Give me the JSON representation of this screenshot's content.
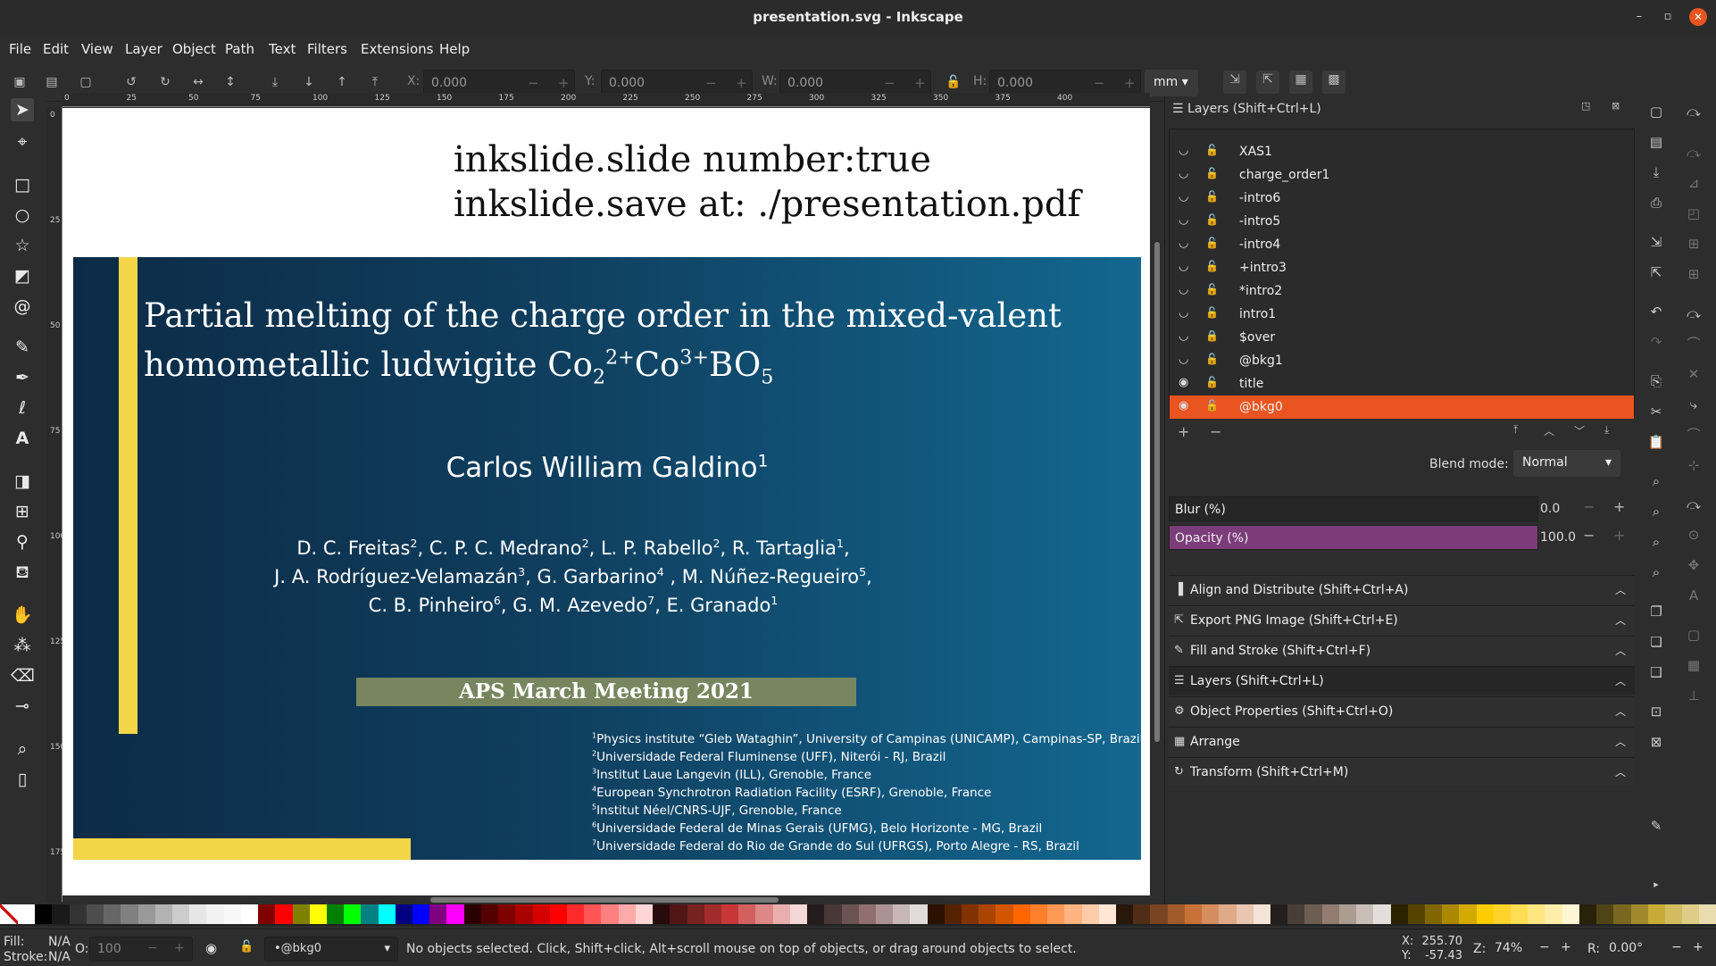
{
  "window": {
    "title": "presentation.svg - Inkscape"
  },
  "menu": [
    "File",
    "Edit",
    "View",
    "Layer",
    "Object",
    "Path",
    "Text",
    "Filters",
    "Extensions",
    "Help"
  ],
  "toolbar": {
    "x_label": "X:",
    "x": "0.000",
    "y_label": "Y:",
    "y": "0.000",
    "w_label": "W:",
    "w": "0.000",
    "h_label": "H:",
    "h": "0.000",
    "unit": "mm",
    "minus": "−",
    "plus": "+"
  },
  "ruler": {
    "h": [
      "0",
      "25",
      "50",
      "75",
      "100",
      "125",
      "150",
      "175",
      "200",
      "225",
      "250",
      "275",
      "300",
      "325",
      "350",
      "375",
      "400"
    ],
    "v": [
      "0",
      "25",
      "50",
      "75",
      "100",
      "125",
      "150",
      "175"
    ]
  },
  "canvas": {
    "note_line1": "inkslide.slide number:true",
    "note_line2": "inkslide.save at: ./presentation.pdf",
    "slide": {
      "title_l1": "Partial melting of the charge order in the mixed-valent",
      "title_l2_pre": "homometallic ludwigite Co",
      "title_sub1": "2",
      "title_sup1": "2+",
      "title_mid": "Co",
      "title_sup2": "3+",
      "title_end": "BO",
      "title_sub2": "5",
      "author": "Carlos William Galdino",
      "author_sup": "1",
      "coauthors": [
        [
          [
            "D. C. Freitas",
            "2"
          ],
          [
            ", C. P. C. Medrano",
            "2"
          ],
          [
            ", L. P. Rabello",
            "2"
          ],
          [
            ", R. Tartaglia",
            "1"
          ],
          [
            ",",
            ""
          ]
        ],
        [
          [
            "J. A. Rodríguez-Velamazán",
            "3"
          ],
          [
            ", G. Garbarino",
            "4"
          ],
          [
            " , M. Núñez-Regueiro",
            "5"
          ],
          [
            ",",
            ""
          ]
        ],
        [
          [
            "C. B. Pinheiro",
            "6"
          ],
          [
            ", G. M. Azevedo",
            "7"
          ],
          [
            ", E. Granado",
            "1"
          ]
        ]
      ],
      "banner": "APS March Meeting 2021",
      "affiliations": [
        {
          "n": "1",
          "t": "Physics institute “Gleb Wataghin”, University of Campinas (UNICAMP), Campinas-SP, Brazil"
        },
        {
          "n": "2",
          "t": "Universidade Federal Fluminense (UFF), Niterói - RJ, Brazil"
        },
        {
          "n": "3",
          "t": "Institut Laue Langevin (ILL),  Grenoble, France"
        },
        {
          "n": "4",
          "t": "European Synchrotron Radiation Facility (ESRF), Grenoble, France"
        },
        {
          "n": "5",
          "t": "Institut Néel/CNRS-UJF, Grenoble, France"
        },
        {
          "n": "6",
          "t": "Universidade Federal de Minas Gerais (UFMG), Belo Horizonte - MG, Brazil"
        },
        {
          "n": "7",
          "t": "Universidade Federal do Rio de Grande do Sul (UFRGS), Porto Alegre - RS, Brazil"
        }
      ]
    }
  },
  "layers_panel": {
    "title": "Layers (Shift+Ctrl+L)",
    "layers": [
      {
        "name": "XAS1",
        "visible": false,
        "locked": false
      },
      {
        "name": "charge_order1",
        "visible": false,
        "locked": false
      },
      {
        "name": "-intro6",
        "visible": false,
        "locked": false
      },
      {
        "name": "-intro5",
        "visible": false,
        "locked": false
      },
      {
        "name": "-intro4",
        "visible": false,
        "locked": false
      },
      {
        "name": "+intro3",
        "visible": false,
        "locked": false
      },
      {
        "name": "*intro2",
        "visible": false,
        "locked": false
      },
      {
        "name": "intro1",
        "visible": false,
        "locked": false
      },
      {
        "name": "$over",
        "visible": false,
        "locked": true
      },
      {
        "name": "@bkg1",
        "visible": false,
        "locked": false
      },
      {
        "name": "title",
        "visible": true,
        "locked": false
      },
      {
        "name": "@bkg0",
        "visible": true,
        "locked": false,
        "selected": true
      }
    ],
    "add": "+",
    "remove": "−",
    "blend_label": "Blend mode:",
    "blend_value": "Normal",
    "blur_label": "Blur (%)",
    "blur_value": "0.0",
    "opacity_label": "Opacity (%)",
    "opacity_value": "100.0",
    "sections": [
      "Align and Distribute (Shift+Ctrl+A)",
      "Export PNG Image (Shift+Ctrl+E)",
      "Fill and Stroke (Shift+Ctrl+F)",
      "Layers (Shift+Ctrl+L)",
      "Object Properties (Shift+Ctrl+O)",
      "Arrange",
      "Transform (Shift+Ctrl+M)"
    ]
  },
  "status": {
    "fill_label": "Fill:",
    "fill_value": "N/A",
    "stroke_label": "Stroke:",
    "stroke_value": "N/A",
    "opacity_label": "O:",
    "opacity_value": "100",
    "layer": "•@bkg0",
    "message": "No objects selected. Click, Shift+click, Alt+scroll mouse on top of objects, or drag around objects to select.",
    "x_label": "X:",
    "x": "255.70",
    "y_label": "Y:",
    "y": "-57.43",
    "zoom_label": "Z:",
    "zoom": "74%",
    "rot_label": "R:",
    "rot": "0.00°"
  },
  "palette": [
    "#ffffff",
    "#000000",
    "#1a1a1a",
    "#333333",
    "#4d4d4d",
    "#666666",
    "#808080",
    "#999999",
    "#b3b3b3",
    "#cccccc",
    "#e6e6e6",
    "#f2f2f2",
    "#f8f8f8",
    "#ffffff",
    "#800000",
    "#ff0000",
    "#808000",
    "#ffff00",
    "#008000",
    "#00ff00",
    "#008080",
    "#00ffff",
    "#000080",
    "#0000ff",
    "#800080",
    "#ff00ff",
    "#2b0000",
    "#550000",
    "#800000",
    "#aa0000",
    "#d40000",
    "#ff0000",
    "#ff2a2a",
    "#ff5555",
    "#ff8080",
    "#ffaaaa",
    "#ffd5d5",
    "#280b0b",
    "#501616",
    "#782121",
    "#a02c2c",
    "#c83737",
    "#d35f5f",
    "#de8787",
    "#e9afaf",
    "#f4d7d7",
    "#241c1c",
    "#483737",
    "#6c5353",
    "#916f6f",
    "#ac9393",
    "#c8b7b7",
    "#e3dbdb",
    "#2b1100",
    "#552200",
    "#803300",
    "#aa4400",
    "#d45500",
    "#ff6600",
    "#ff7f2a",
    "#ff9955",
    "#ffb380",
    "#ffccaa",
    "#ffe6d5",
    "#28170b",
    "#502d16",
    "#784421",
    "#a05a2c",
    "#c87137",
    "#d38d5f",
    "#deaa87",
    "#e9c6af",
    "#f4e3d7",
    "#241f1c",
    "#483e37",
    "#6c5d53",
    "#917c6f",
    "#ac9d93",
    "#c8beb7",
    "#e3dedb",
    "#2b2200",
    "#554400",
    "#806600",
    "#aa8800",
    "#d4aa00",
    "#ffcc00",
    "#ffd42a",
    "#ffdd55",
    "#ffe680",
    "#ffeeaa",
    "#fff6d5",
    "#28220b",
    "#504416",
    "#786721",
    "#a0892c",
    "#c8ab37",
    "#d3bc5f",
    "#decd87",
    "#e9ddaf"
  ]
}
